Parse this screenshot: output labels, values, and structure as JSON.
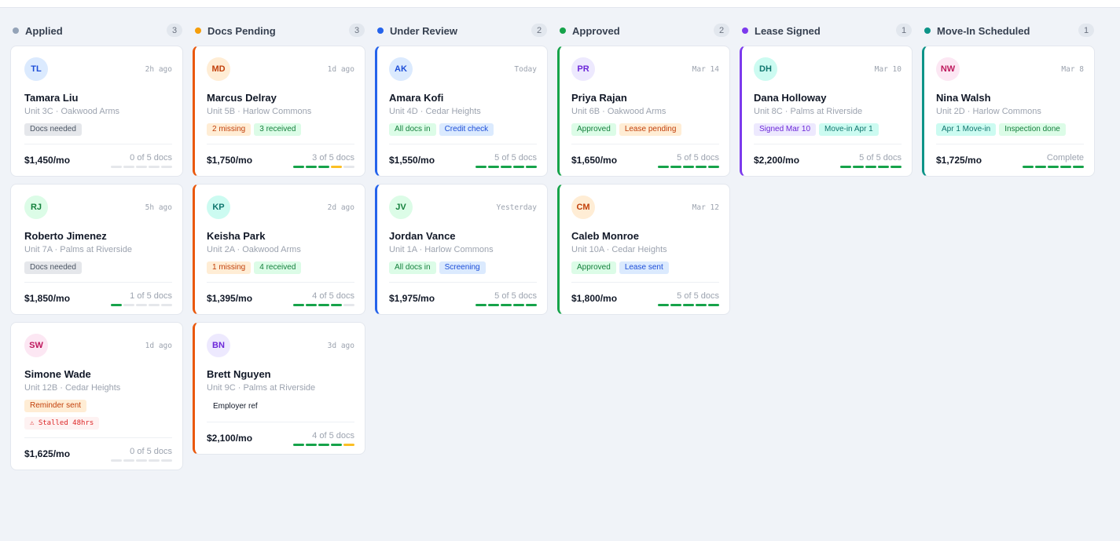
{
  "columns": [
    {
      "title": "Applied",
      "count": "3",
      "color": "#94a3b8",
      "cards": [
        {
          "initials": "TL",
          "avatar_bg": "#dbeafe",
          "avatar_fg": "#1d4ed8",
          "time": "2h ago",
          "name": "Tamara Liu",
          "unit": "Unit 3C · Oakwood Arms",
          "tags": [
            {
              "label": "Docs needed",
              "kind": "gray"
            }
          ],
          "price": "$1,450/mo",
          "docs_label": "0 of 5 docs",
          "segments": [
            "empty",
            "empty",
            "empty",
            "empty",
            "empty"
          ]
        },
        {
          "initials": "RJ",
          "avatar_bg": "#dcfce7",
          "avatar_fg": "#15803d",
          "time": "5h ago",
          "name": "Roberto Jimenez",
          "unit": "Unit 7A · Palms at Riverside",
          "tags": [
            {
              "label": "Docs needed",
              "kind": "gray"
            }
          ],
          "price": "$1,850/mo",
          "docs_label": "1 of 5 docs",
          "segments": [
            "green",
            "empty",
            "empty",
            "empty",
            "empty"
          ]
        },
        {
          "initials": "SW",
          "avatar_bg": "#fce7f3",
          "avatar_fg": "#be185d",
          "time": "1d ago",
          "name": "Simone Wade",
          "unit": "Unit 12B · Cedar Heights",
          "tags": [
            {
              "label": "Reminder sent",
              "kind": "orange"
            }
          ],
          "stall": "⚠ Stalled 48hrs",
          "price": "$1,625/mo",
          "docs_label": "0 of 5 docs",
          "segments": [
            "empty",
            "empty",
            "empty",
            "empty",
            "empty"
          ]
        }
      ]
    },
    {
      "title": "Docs Pending",
      "count": "3",
      "color": "#f59e0b",
      "accent": "#ea580c",
      "cards": [
        {
          "initials": "MD",
          "avatar_bg": "#ffedd5",
          "avatar_fg": "#c2410c",
          "time": "1d ago",
          "name": "Marcus Delray",
          "unit": "Unit 5B · Harlow Commons",
          "tags": [
            {
              "label": "2 missing",
              "kind": "orange"
            },
            {
              "label": "3 received",
              "kind": "green"
            }
          ],
          "price": "$1,750/mo",
          "docs_label": "3 of 5 docs",
          "segments": [
            "green",
            "green",
            "green",
            "yellow",
            "empty"
          ]
        },
        {
          "initials": "KP",
          "avatar_bg": "#ccfbf1",
          "avatar_fg": "#0f766e",
          "time": "2d ago",
          "name": "Keisha Park",
          "unit": "Unit 2A · Oakwood Arms",
          "tags": [
            {
              "label": "1 missing",
              "kind": "orange"
            },
            {
              "label": "4 received",
              "kind": "green"
            }
          ],
          "price": "$1,395/mo",
          "docs_label": "4 of 5 docs",
          "segments": [
            "green",
            "green",
            "green",
            "green",
            "empty"
          ]
        },
        {
          "initials": "BN",
          "avatar_bg": "#ede9fe",
          "avatar_fg": "#6d28d9",
          "time": "3d ago",
          "name": "Brett Nguyen",
          "unit": "Unit 9C · Palms at Riverside",
          "tags": [
            {
              "label": "Employer ref",
              "kind": "plain"
            }
          ],
          "price": "$2,100/mo",
          "docs_label": "4 of 5 docs",
          "segments": [
            "green",
            "green",
            "green",
            "green",
            "yellow"
          ]
        }
      ]
    },
    {
      "title": "Under Review",
      "count": "2",
      "color": "#2563eb",
      "accent": "#2563eb",
      "cards": [
        {
          "initials": "AK",
          "avatar_bg": "#dbeafe",
          "avatar_fg": "#1d4ed8",
          "time": "Today",
          "name": "Amara Kofi",
          "unit": "Unit 4D · Cedar Heights",
          "tags": [
            {
              "label": "All docs in",
              "kind": "green"
            },
            {
              "label": "Credit check",
              "kind": "blue"
            }
          ],
          "price": "$1,550/mo",
          "docs_label": "5 of 5 docs",
          "segments": [
            "green",
            "green",
            "green",
            "green",
            "green"
          ]
        },
        {
          "initials": "JV",
          "avatar_bg": "#dcfce7",
          "avatar_fg": "#15803d",
          "time": "Yesterday",
          "name": "Jordan Vance",
          "unit": "Unit 1A · Harlow Commons",
          "tags": [
            {
              "label": "All docs in",
              "kind": "green"
            },
            {
              "label": "Screening",
              "kind": "blue"
            }
          ],
          "price": "$1,975/mo",
          "docs_label": "5 of 5 docs",
          "segments": [
            "green",
            "green",
            "green",
            "green",
            "green"
          ]
        }
      ]
    },
    {
      "title": "Approved",
      "count": "2",
      "color": "#16a34a",
      "accent": "#16a34a",
      "cards": [
        {
          "initials": "PR",
          "avatar_bg": "#ede9fe",
          "avatar_fg": "#6d28d9",
          "time": "Mar 14",
          "name": "Priya Rajan",
          "unit": "Unit 6B · Oakwood Arms",
          "tags": [
            {
              "label": "Approved",
              "kind": "green"
            },
            {
              "label": "Lease pending",
              "kind": "orange"
            }
          ],
          "price": "$1,650/mo",
          "docs_label": "5 of 5 docs",
          "segments": [
            "green",
            "green",
            "green",
            "green",
            "green"
          ]
        },
        {
          "initials": "CM",
          "avatar_bg": "#ffedd5",
          "avatar_fg": "#c2410c",
          "time": "Mar 12",
          "name": "Caleb Monroe",
          "unit": "Unit 10A · Cedar Heights",
          "tags": [
            {
              "label": "Approved",
              "kind": "green"
            },
            {
              "label": "Lease sent",
              "kind": "blue"
            }
          ],
          "price": "$1,800/mo",
          "docs_label": "5 of 5 docs",
          "segments": [
            "green",
            "green",
            "green",
            "green",
            "green"
          ]
        }
      ]
    },
    {
      "title": "Lease Signed",
      "count": "1",
      "color": "#7c3aed",
      "accent": "#7c3aed",
      "cards": [
        {
          "initials": "DH",
          "avatar_bg": "#ccfbf1",
          "avatar_fg": "#0f766e",
          "time": "Mar 10",
          "name": "Dana Holloway",
          "unit": "Unit 8C · Palms at Riverside",
          "tags": [
            {
              "label": "Signed Mar 10",
              "kind": "purple"
            },
            {
              "label": "Move-in Apr 1",
              "kind": "teal"
            }
          ],
          "price": "$2,200/mo",
          "docs_label": "5 of 5 docs",
          "segments": [
            "green",
            "green",
            "green",
            "green",
            "green"
          ]
        }
      ]
    },
    {
      "title": "Move-In Scheduled",
      "count": "1",
      "color": "#0d9488",
      "accent": "#0d9488",
      "cards": [
        {
          "initials": "NW",
          "avatar_bg": "#fce7f3",
          "avatar_fg": "#be185d",
          "time": "Mar 8",
          "name": "Nina Walsh",
          "unit": "Unit 2D · Harlow Commons",
          "tags": [
            {
              "label": "Apr 1 Move-in",
              "kind": "teal"
            },
            {
              "label": "Inspection done",
              "kind": "green"
            }
          ],
          "price": "$1,725/mo",
          "docs_label": "Complete",
          "segments": [
            "green",
            "green",
            "green",
            "green",
            "green"
          ]
        }
      ]
    }
  ],
  "segment_colors": {
    "green": "#16a34a",
    "yellow": "#fbbf24",
    "empty": "#e5e7eb"
  }
}
